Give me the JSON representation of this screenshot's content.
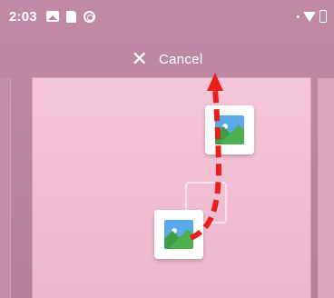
{
  "status_bar": {
    "time": "2:03",
    "icons": [
      "gallery-icon",
      "sdcard-icon",
      "sync-icon",
      "dot-icon",
      "wifi-icon",
      "battery-icon"
    ]
  },
  "drag_bar": {
    "close_glyph": "✕",
    "cancel_label": "Cancel"
  },
  "workspace": {
    "dragged_app_icon": "gallery-app-icon",
    "drop_target_icon": "gallery-app-icon",
    "drag_indicator_color": "#e8201c"
  },
  "colors": {
    "background": "#bc86a0",
    "panel": "#f3c2d7",
    "arrow": "#e8201c"
  }
}
